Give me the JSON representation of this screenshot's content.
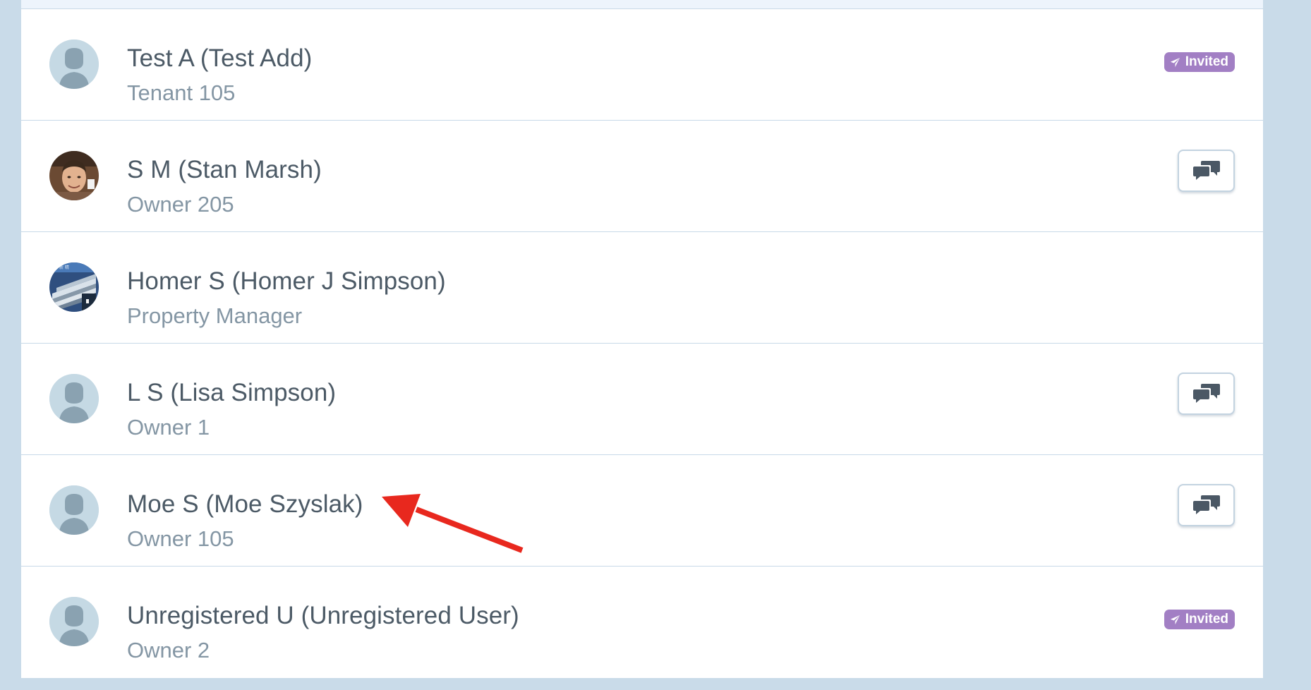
{
  "members": [
    {
      "name": "Test A (Test Add)",
      "role": "Tenant 105",
      "avatar": "default-user-icon",
      "action": "badge"
    },
    {
      "name": "S M (Stan Marsh)",
      "role": "Owner 205",
      "avatar": "photo-portrait",
      "action": "chat"
    },
    {
      "name": "Homer S (Homer J Simpson)",
      "role": "Property Manager",
      "avatar": "photo-building",
      "action": "none"
    },
    {
      "name": "L S (Lisa Simpson)",
      "role": "Owner 1",
      "avatar": "default-user-icon",
      "action": "chat"
    },
    {
      "name": "Moe S (Moe Szyslak)",
      "role": "Owner 105",
      "avatar": "default-user-icon",
      "action": "chat"
    },
    {
      "name": "Unregistered U (Unregistered User)",
      "role": "Owner 2",
      "avatar": "default-user-icon",
      "action": "badge"
    }
  ],
  "badge": {
    "label": "Invited",
    "icon": "paper-plane-icon"
  },
  "chat_button": {
    "icon": "chat-bubbles-icon"
  },
  "colors": {
    "background": "#c9dbe9",
    "badge": "#a27fc4",
    "name_text": "#4c5a66",
    "role_text": "#8496a4",
    "annotation_arrow": "#e8281e"
  }
}
